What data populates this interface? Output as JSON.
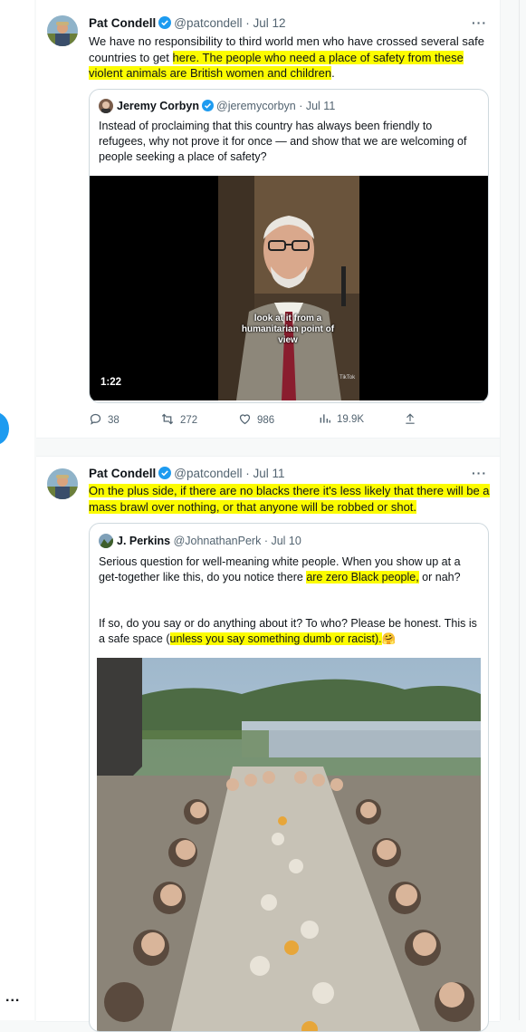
{
  "tweets": [
    {
      "author": "Pat Condell",
      "handle": "@patcondell",
      "date": "· Jul 12",
      "more": "···",
      "text_parts": {
        "a": "We have no responsibility to third world men who have crossed several safe countries to get ",
        "b": "here. The people who need a place of safety from these violent animals are British women and children",
        "c": "."
      },
      "quote": {
        "author": "Jeremy Corbyn",
        "handle": "@jeremycorbyn",
        "date": "· Jul 11",
        "text": "Instead of proclaiming that this country has always been friendly to refugees, why not prove it for once — and show that we are welcoming of people seeking a place of safety?",
        "video_caption": "look at it from a humanitarian point of view",
        "watermark": "TikTok",
        "duration": "1:22"
      },
      "actions": {
        "replies": "38",
        "retweets": "272",
        "likes": "986",
        "views": "19.9K"
      }
    },
    {
      "author": "Pat Condell",
      "handle": "@patcondell",
      "date": "· Jul 11",
      "more": "···",
      "text": "On the plus side, if there are no blacks there it's less likely that there will be a mass brawl over nothing, or that anyone will be robbed or shot.",
      "quote": {
        "author": "J. Perkins",
        "handle": "@JohnathanPerk",
        "date": "· Jul 10",
        "p1_parts": {
          "a": "Serious question for well-meaning white people. When you show up at a get-together like this, do you notice there ",
          "b": "are zero Black people,",
          "c": " or nah?"
        },
        "p2_parts": {
          "a": "If so, do you say or do anything about it? To who? Please be honest. This is a safe space (",
          "b": "unless you say something dumb or racist).",
          "emoji": "🤗"
        }
      }
    }
  ],
  "left_more": "...",
  "colors": {
    "highlight": "#fcfc00",
    "verified": "#1d9bf0",
    "muted": "#536471"
  }
}
